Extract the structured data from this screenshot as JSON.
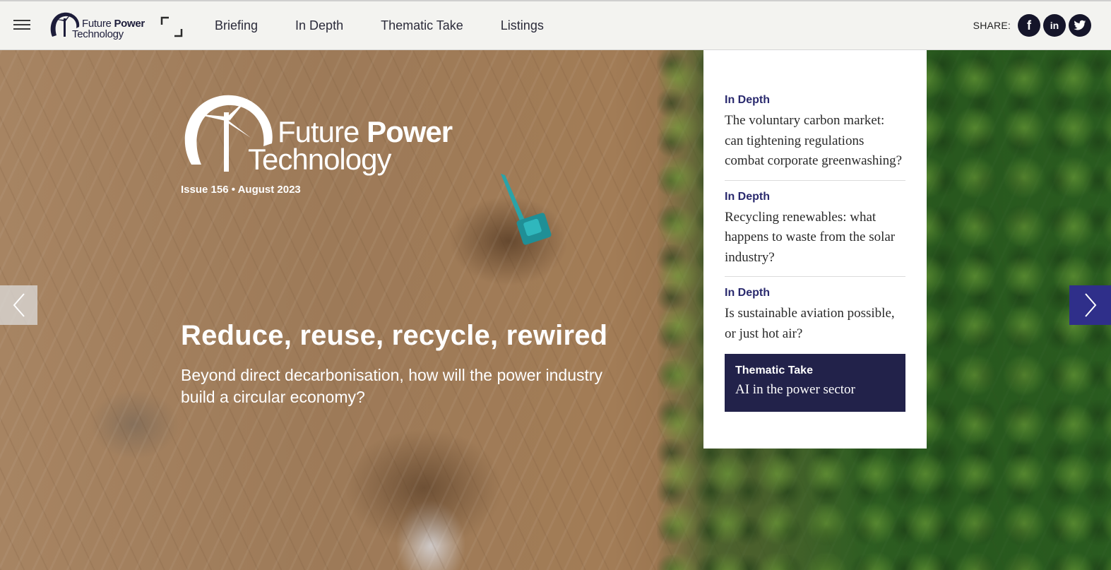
{
  "header": {
    "logo_line1_regular": "Future",
    "logo_line1_bold": "Power",
    "logo_line2": "Technology",
    "nav": [
      "Briefing",
      "In Depth",
      "Thematic Take",
      "Listings"
    ],
    "share_label": "SHARE:",
    "social": {
      "facebook": "f",
      "linkedin": "in"
    }
  },
  "hero": {
    "logo_line1_regular": "Future",
    "logo_line1_bold": "Power",
    "logo_line2": "Technology",
    "issue": "Issue 156 • August 2023",
    "headline": "Reduce, reuse, recycle, rewired",
    "subhead": "Beyond direct decarbonisation, how will the power industry build a circular economy?"
  },
  "panel": {
    "stories": [
      {
        "category": "In Depth",
        "title": "The voluntary carbon market: can tightening regulations combat corporate greenwashing?"
      },
      {
        "category": "In Depth",
        "title": "Recycling renewables: what happens to waste from the solar industry?"
      },
      {
        "category": "In Depth",
        "title": "Is sustainable aviation possible, or just hot air?"
      }
    ],
    "thematic": {
      "category": "Thematic Take",
      "title": "AI in the power sector"
    }
  },
  "colors": {
    "brand_navy": "#22224a",
    "accent_blue": "#2f2f8a",
    "header_bg": "#f3f3f0"
  }
}
